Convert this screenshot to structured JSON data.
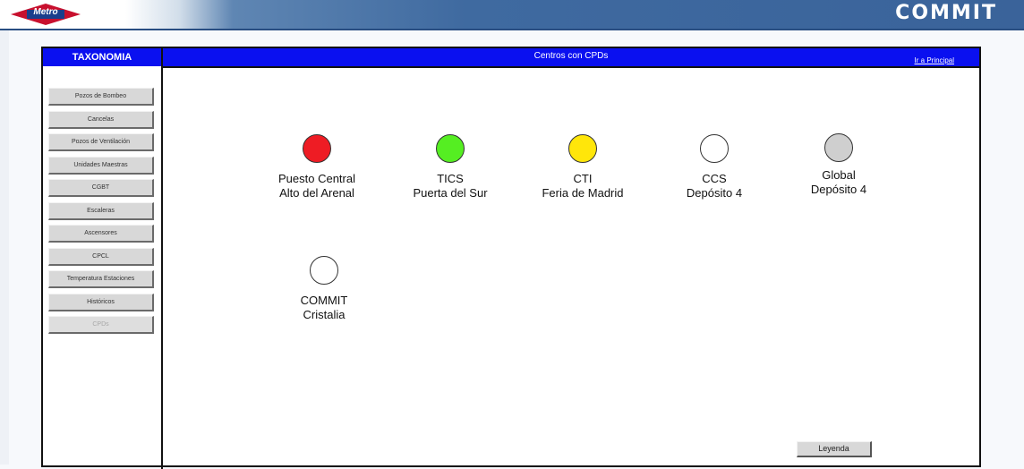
{
  "app_title": "COMMIT",
  "logo_text": "Metro",
  "colors": {
    "header_blue": "#0a10f0",
    "red": "#ee1c24",
    "green": "#55ee22",
    "yellow": "#ffe60a",
    "white": "#ffffff",
    "gray": "#cfcfcf"
  },
  "sidebar": {
    "title": "TAXONOMIA",
    "items": [
      {
        "label": "Pozos de Bombeo",
        "enabled": true
      },
      {
        "label": "Cancelas",
        "enabled": true
      },
      {
        "label": "Pozos de Ventilación",
        "enabled": true
      },
      {
        "label": "Unidades Maestras",
        "enabled": true
      },
      {
        "label": "CGBT",
        "enabled": true
      },
      {
        "label": "Escaleras",
        "enabled": true
      },
      {
        "label": "Ascensores",
        "enabled": true
      },
      {
        "label": "CPCL",
        "enabled": true
      },
      {
        "label": "Temperatura Estaciones",
        "enabled": true
      },
      {
        "label": "Históricos",
        "enabled": true
      },
      {
        "label": "CPDs",
        "enabled": false
      }
    ]
  },
  "main": {
    "title": "Centros con CPDs",
    "link_main": "Ir a Principal",
    "centers": [
      {
        "line1": "Puesto Central",
        "line2": "Alto del Arenal",
        "status": "red"
      },
      {
        "line1": "TICS",
        "line2": "Puerta del Sur",
        "status": "green"
      },
      {
        "line1": "CTI",
        "line2": "Feria de Madrid",
        "status": "yellow"
      },
      {
        "line1": "CCS",
        "line2": "Depósito 4",
        "status": "white"
      },
      {
        "line1": "Global",
        "line2": "Depósito 4",
        "status": "gray"
      },
      {
        "line1": "COMMIT",
        "line2": "Cristalia",
        "status": "white"
      }
    ],
    "legend_button": "Leyenda"
  }
}
